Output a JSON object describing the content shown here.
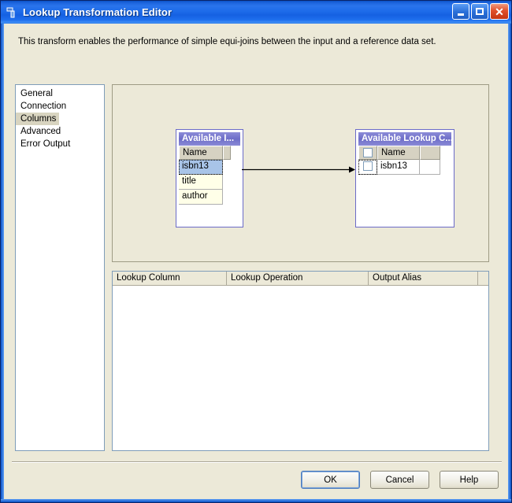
{
  "window": {
    "title": "Lookup Transformation Editor",
    "icon": "lookup-transform-icon",
    "controls": {
      "minimize": "_",
      "maximize": "□",
      "close": "✕"
    }
  },
  "description": "This transform enables the performance of simple equi-joins between the input and a reference data set.",
  "nav": {
    "items": [
      {
        "label": "General",
        "selected": false
      },
      {
        "label": "Connection",
        "selected": false
      },
      {
        "label": "Columns",
        "selected": true
      },
      {
        "label": "Advanced",
        "selected": false
      },
      {
        "label": "Error Output",
        "selected": false
      }
    ]
  },
  "diagram": {
    "input_table": {
      "title": "Available I...",
      "column_header": "Name",
      "rows": [
        {
          "name": "isbn13",
          "selected": true,
          "focused": true
        },
        {
          "name": "title",
          "selected": false,
          "focused": false
        },
        {
          "name": "author",
          "selected": false,
          "focused": false
        }
      ]
    },
    "lookup_table": {
      "title": "Available Lookup C...",
      "column_header": "Name",
      "rows": [
        {
          "checked": false,
          "name": "isbn13",
          "focused": true
        }
      ]
    },
    "connector": {
      "from": "isbn13",
      "to": "isbn13",
      "direction": "right"
    }
  },
  "grid": {
    "columns": [
      "Lookup Column",
      "Lookup Operation",
      "Output Alias"
    ],
    "rows": []
  },
  "buttons": {
    "ok": "OK",
    "cancel": "Cancel",
    "help": "Help"
  },
  "colors": {
    "titlebar_blue": "#1E6CEA",
    "dialog_face": "#ECE9D8",
    "selection_blue": "#A8C4E8",
    "table_header_purple": "#6E6EC8",
    "close_red": "#E0502A"
  }
}
